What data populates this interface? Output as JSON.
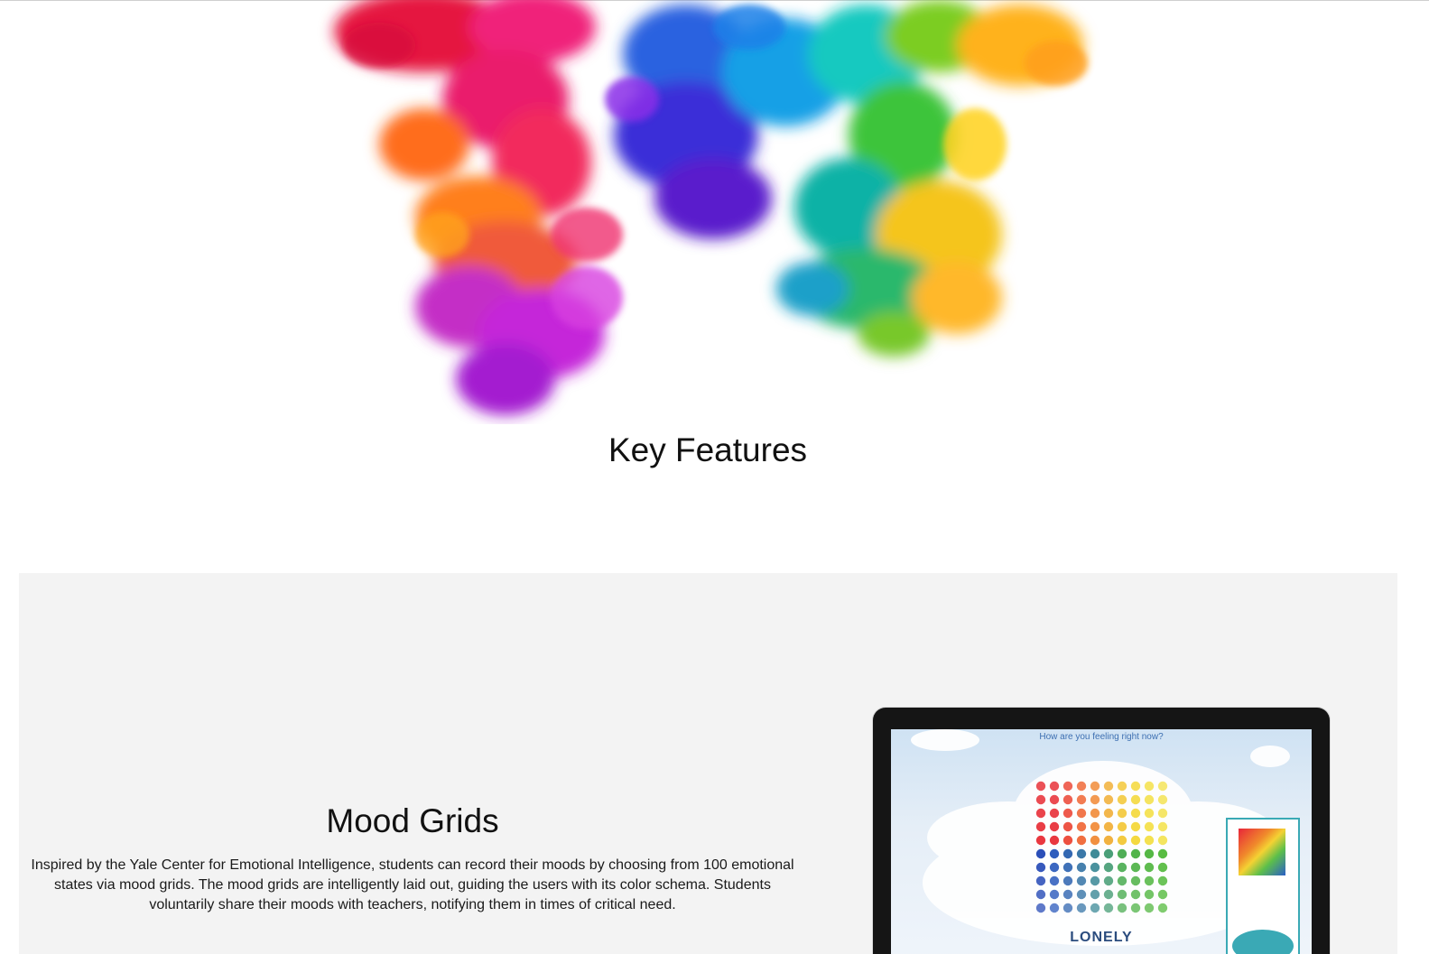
{
  "hero": {
    "image": "rainbow-ink-smoke-image"
  },
  "section": {
    "title": "Key Features"
  },
  "feature": {
    "title": "Mood Grids",
    "description": "Inspired by the Yale Center for Emotional Intelligence, students can record their moods by choosing from 100 emotional states via mood grids. The mood grids are intelligently laid out, guiding the users with its color schema. Students voluntarily share their moods with teachers, notifying them in times of critical need.",
    "device_screen": {
      "question": "How are you feeling right now?",
      "selected_mood": "LONELY"
    }
  },
  "colors": {
    "panel_background": "#f3f3f3",
    "laptop_bezel": "#151515",
    "screen_text": "#3d6fb2"
  }
}
